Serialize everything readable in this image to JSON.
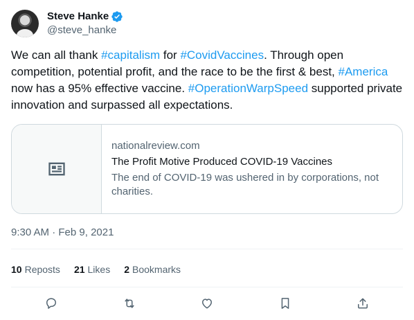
{
  "author": {
    "display_name": "Steve Hanke",
    "handle": "@steve_hanke"
  },
  "tweet": {
    "segments": [
      {
        "text": "We can all thank ",
        "type": "text"
      },
      {
        "text": "#capitalism",
        "type": "hashtag"
      },
      {
        "text": " for ",
        "type": "text"
      },
      {
        "text": "#CovidVaccines",
        "type": "hashtag"
      },
      {
        "text": ". Through open competition, potential profit, and the race to be the first & best, ",
        "type": "text"
      },
      {
        "text": "#America",
        "type": "hashtag"
      },
      {
        "text": " now has a 95% effective vaccine. ",
        "type": "text"
      },
      {
        "text": "#OperationWarpSpeed",
        "type": "hashtag"
      },
      {
        "text": " supported private innovation and surpassed all expectations.",
        "type": "text"
      }
    ]
  },
  "link_card": {
    "domain": "nationalreview.com",
    "title": "The Profit Motive Produced COVID-19 Vaccines",
    "description": "The end of COVID-19 was ushered in by corporations, not charities.",
    "icon": "article-icon"
  },
  "meta": {
    "time": "9:30 AM",
    "separator": " · ",
    "date": "Feb 9, 2021"
  },
  "stats": {
    "reposts_count": "10",
    "reposts_label": "Reposts",
    "likes_count": "21",
    "likes_label": "Likes",
    "bookmarks_count": "2",
    "bookmarks_label": "Bookmarks"
  },
  "actions": {
    "reply_icon": "reply-icon",
    "repost_icon": "repost-icon",
    "like_icon": "like-icon",
    "bookmark_icon": "bookmark-icon",
    "share_icon": "share-icon"
  },
  "colors": {
    "accent": "#1d9bf0",
    "text": "#0f1419",
    "secondary": "#536471",
    "border": "#cfd9de"
  }
}
